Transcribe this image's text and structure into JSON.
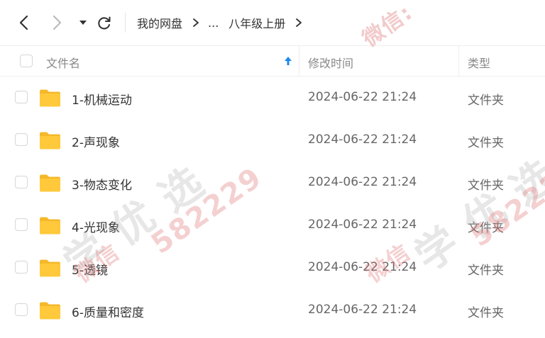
{
  "toolbar": {
    "back_icon": "chevron-left-icon",
    "forward_icon": "chevron-right-icon",
    "dropdown_icon": "caret-down-icon",
    "refresh_icon": "refresh-icon"
  },
  "breadcrumb": {
    "items": [
      "我的网盘",
      "...",
      "八年级上册"
    ]
  },
  "columns": {
    "name": "文件名",
    "modified": "修改时间",
    "type": "类型"
  },
  "files": [
    {
      "name": "1-机械运动",
      "modified": "2024-06-22 21:24",
      "type": "文件夹"
    },
    {
      "name": "2-声现象",
      "modified": "2024-06-22 21:24",
      "type": "文件夹"
    },
    {
      "name": "3-物态变化",
      "modified": "2024-06-22 21:24",
      "type": "文件夹"
    },
    {
      "name": "4-光现象",
      "modified": "2024-06-22 21:24",
      "type": "文件夹"
    },
    {
      "name": "5-透镜",
      "modified": "2024-06-22 21:24",
      "type": "文件夹"
    },
    {
      "name": "6-质量和密度",
      "modified": "2024-06-22 21:24",
      "type": "文件夹"
    }
  ],
  "watermark": {
    "lines": [
      "微信:",
      "学 优 选",
      "582229",
      "微信"
    ]
  },
  "colors": {
    "accent": "#1a88f0",
    "folder": "#ffc93b",
    "folder_back": "#f5b82a",
    "watermark_gray": "#ababab",
    "watermark_red": "#e07070"
  }
}
